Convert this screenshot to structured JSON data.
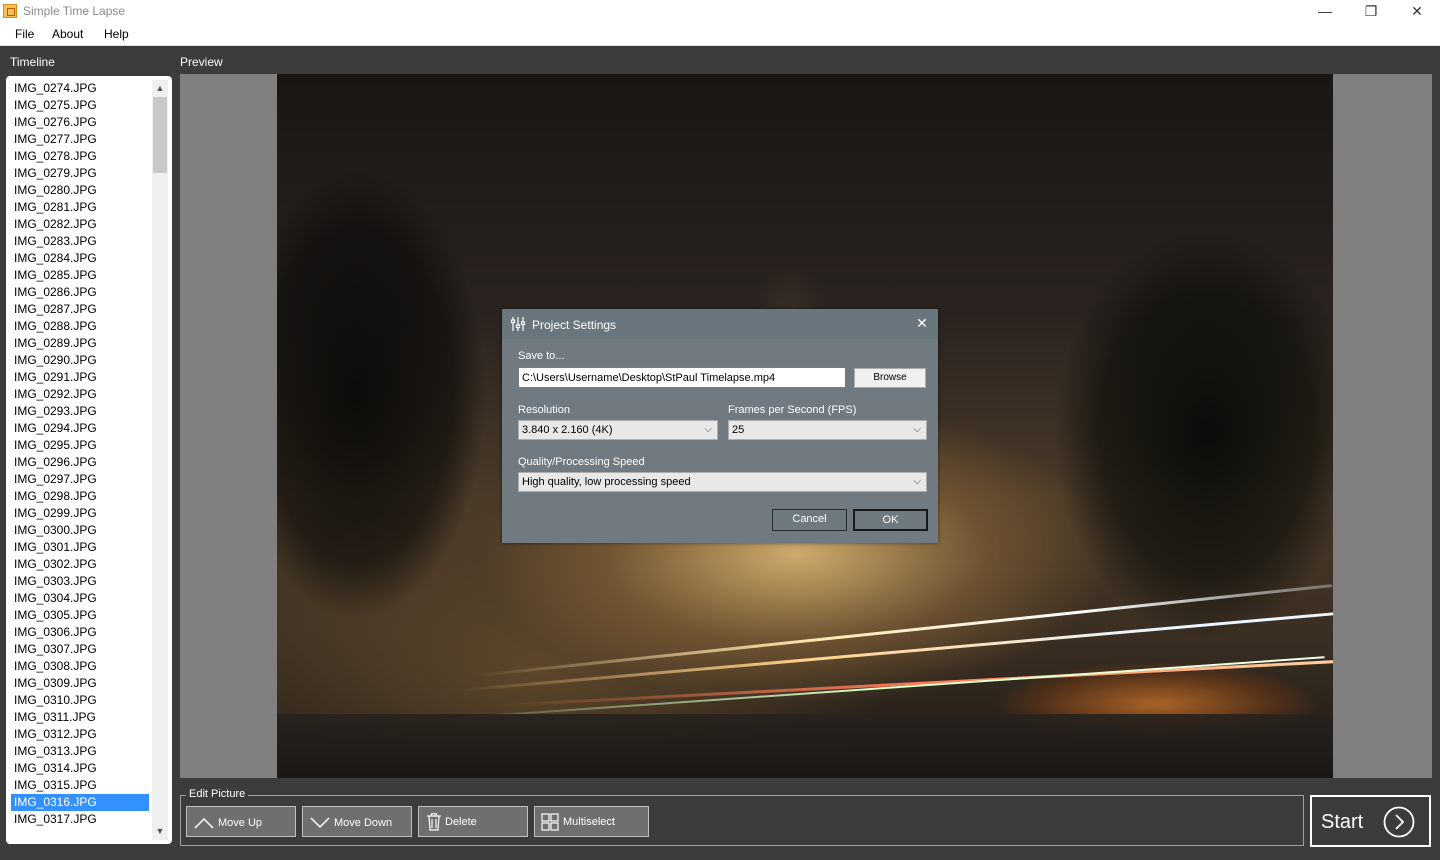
{
  "window": {
    "title": "Simple Time Lapse",
    "min_glyph": "—",
    "max_glyph": "❐",
    "close_glyph": "✕"
  },
  "menu": {
    "file": "File",
    "about": "About",
    "help": "Help"
  },
  "timeline": {
    "label": "Timeline",
    "items": [
      "IMG_0274.JPG",
      "IMG_0275.JPG",
      "IMG_0276.JPG",
      "IMG_0277.JPG",
      "IMG_0278.JPG",
      "IMG_0279.JPG",
      "IMG_0280.JPG",
      "IMG_0281.JPG",
      "IMG_0282.JPG",
      "IMG_0283.JPG",
      "IMG_0284.JPG",
      "IMG_0285.JPG",
      "IMG_0286.JPG",
      "IMG_0287.JPG",
      "IMG_0288.JPG",
      "IMG_0289.JPG",
      "IMG_0290.JPG",
      "IMG_0291.JPG",
      "IMG_0292.JPG",
      "IMG_0293.JPG",
      "IMG_0294.JPG",
      "IMG_0295.JPG",
      "IMG_0296.JPG",
      "IMG_0297.JPG",
      "IMG_0298.JPG",
      "IMG_0299.JPG",
      "IMG_0300.JPG",
      "IMG_0301.JPG",
      "IMG_0302.JPG",
      "IMG_0303.JPG",
      "IMG_0304.JPG",
      "IMG_0305.JPG",
      "IMG_0306.JPG",
      "IMG_0307.JPG",
      "IMG_0308.JPG",
      "IMG_0309.JPG",
      "IMG_0310.JPG",
      "IMG_0311.JPG",
      "IMG_0312.JPG",
      "IMG_0313.JPG",
      "IMG_0314.JPG",
      "IMG_0315.JPG",
      "IMG_0316.JPG",
      "IMG_0317.JPG"
    ],
    "selected": "IMG_0316.JPG",
    "scroll_up_glyph": "▲",
    "scroll_down_glyph": "▼"
  },
  "preview": {
    "label": "Preview"
  },
  "dialog": {
    "title": "Project Settings",
    "close_glyph": "✕",
    "save_to_label": "Save to...",
    "save_path": "C:\\Users\\Username\\Desktop\\StPaul Timelapse.mp4",
    "browse_label": "Browse",
    "resolution_label": "Resolution",
    "resolution_value": "3.840 x 2.160 (4K)",
    "fps_label": "Frames per Second (FPS)",
    "fps_value": "25",
    "quality_label": "Quality/Processing Speed",
    "quality_value": "High quality, low processing speed",
    "cancel_label": "Cancel",
    "ok_label": "OK",
    "chevron_glyph": "⌵"
  },
  "edit_picture": {
    "legend": "Edit Picture",
    "move_up": "Move Up",
    "move_down": "Move Down",
    "delete": "Delete",
    "multiselect": "Multiselect"
  },
  "start": {
    "label": "Start"
  },
  "icons": {
    "app": "app-icon",
    "settings": "sliders-icon",
    "move_up": "chevron-up-icon",
    "move_down": "chevron-down-icon",
    "delete": "trash-icon",
    "multiselect": "grid-icon",
    "start": "play-circle-icon"
  },
  "colors": {
    "background": "#3c3c3c",
    "selection": "#3390ff",
    "dialog": "#707a80",
    "preview_bg": "#808080"
  }
}
